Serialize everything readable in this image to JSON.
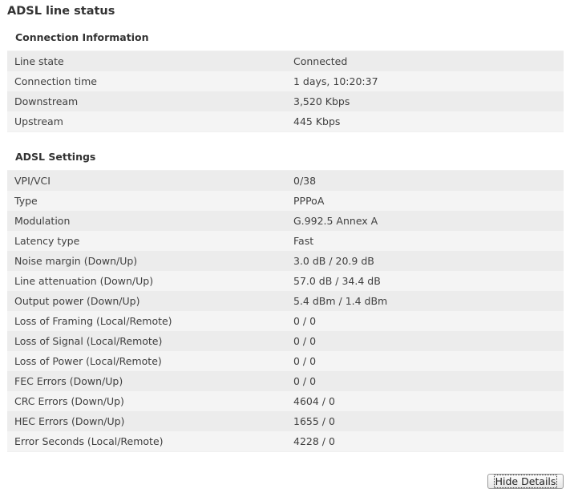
{
  "page": {
    "title": "ADSL line status"
  },
  "connection": {
    "title": "Connection Information",
    "rows": [
      {
        "label": "Line state",
        "value": "Connected"
      },
      {
        "label": "Connection time",
        "value": "1 days, 10:20:37"
      },
      {
        "label": "Downstream",
        "value": "3,520 Kbps"
      },
      {
        "label": "Upstream",
        "value": "445 Kbps"
      }
    ]
  },
  "adsl": {
    "title": "ADSL Settings",
    "rows": [
      {
        "label": "VPI/VCI",
        "value": "0/38"
      },
      {
        "label": "Type",
        "value": "PPPoA"
      },
      {
        "label": "Modulation",
        "value": "G.992.5 Annex A"
      },
      {
        "label": "Latency type",
        "value": "Fast"
      },
      {
        "label": "Noise margin (Down/Up)",
        "value": "3.0 dB / 20.9 dB"
      },
      {
        "label": "Line attenuation (Down/Up)",
        "value": "57.0 dB / 34.4 dB"
      },
      {
        "label": "Output power (Down/Up)",
        "value": "5.4 dBm / 1.4 dBm"
      },
      {
        "label": "Loss of Framing (Local/Remote)",
        "value": "0 / 0"
      },
      {
        "label": "Loss of Signal (Local/Remote)",
        "value": "0 / 0"
      },
      {
        "label": "Loss of Power (Local/Remote)",
        "value": "0 / 0"
      },
      {
        "label": "FEC Errors (Down/Up)",
        "value": "0 / 0"
      },
      {
        "label": "CRC Errors (Down/Up)",
        "value": "4604 / 0"
      },
      {
        "label": "HEC Errors (Down/Up)",
        "value": "1655 / 0"
      },
      {
        "label": "Error Seconds (Local/Remote)",
        "value": "4228 / 0"
      }
    ]
  },
  "actions": {
    "hide_details_label": "Hide Details"
  }
}
